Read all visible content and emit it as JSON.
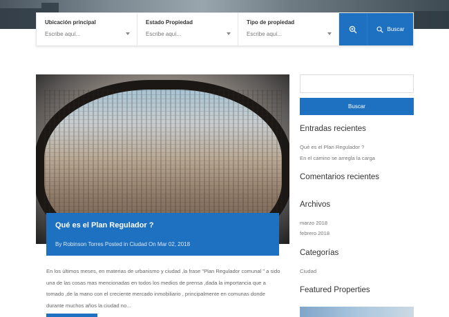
{
  "search": {
    "fields": [
      {
        "label": "Ubicación principal",
        "placeholder": "Escribe aquí..."
      },
      {
        "label": "Estado Propiedad",
        "placeholder": "Escribe aquí..."
      },
      {
        "label": "Tipo de propiedad",
        "placeholder": "Escribe aquí..."
      }
    ],
    "advanced_icon": "zoom-plus-icon",
    "button_label": "Buscar",
    "button_icon": "search-icon"
  },
  "post": {
    "title": "Qué es el Plan Regulador ?",
    "meta": "By Robinson Torres Posted in Ciudad On Mar 02, 2018",
    "excerpt": "En los últimos meses, en materias de urbanismo y ciudad ,la frase \"Plan Regulador comunal \" a sido una de las cosas mas mencionadas en todos los medios de prensa ,dada la importancia que a tomado ,de la mano con el creciente mercado inmobiliario , principalmente en comunas donde durante muchos años la ciudad no..."
  },
  "sidebar": {
    "search_button": "Buscar",
    "recent_posts_title": "Entradas recientes",
    "recent_posts": [
      "Qué es el Plan Regulador ?",
      "En el camino se arregla la carga"
    ],
    "recent_comments_title": "Comentarios recientes",
    "archives_title": "Archivos",
    "archives": [
      "marzo 2018",
      "febrero 2018"
    ],
    "categories_title": "Categorías",
    "categories": [
      "Ciudad"
    ],
    "featured_title": "Featured Properties"
  },
  "colors": {
    "accent": "#1e70c1"
  }
}
